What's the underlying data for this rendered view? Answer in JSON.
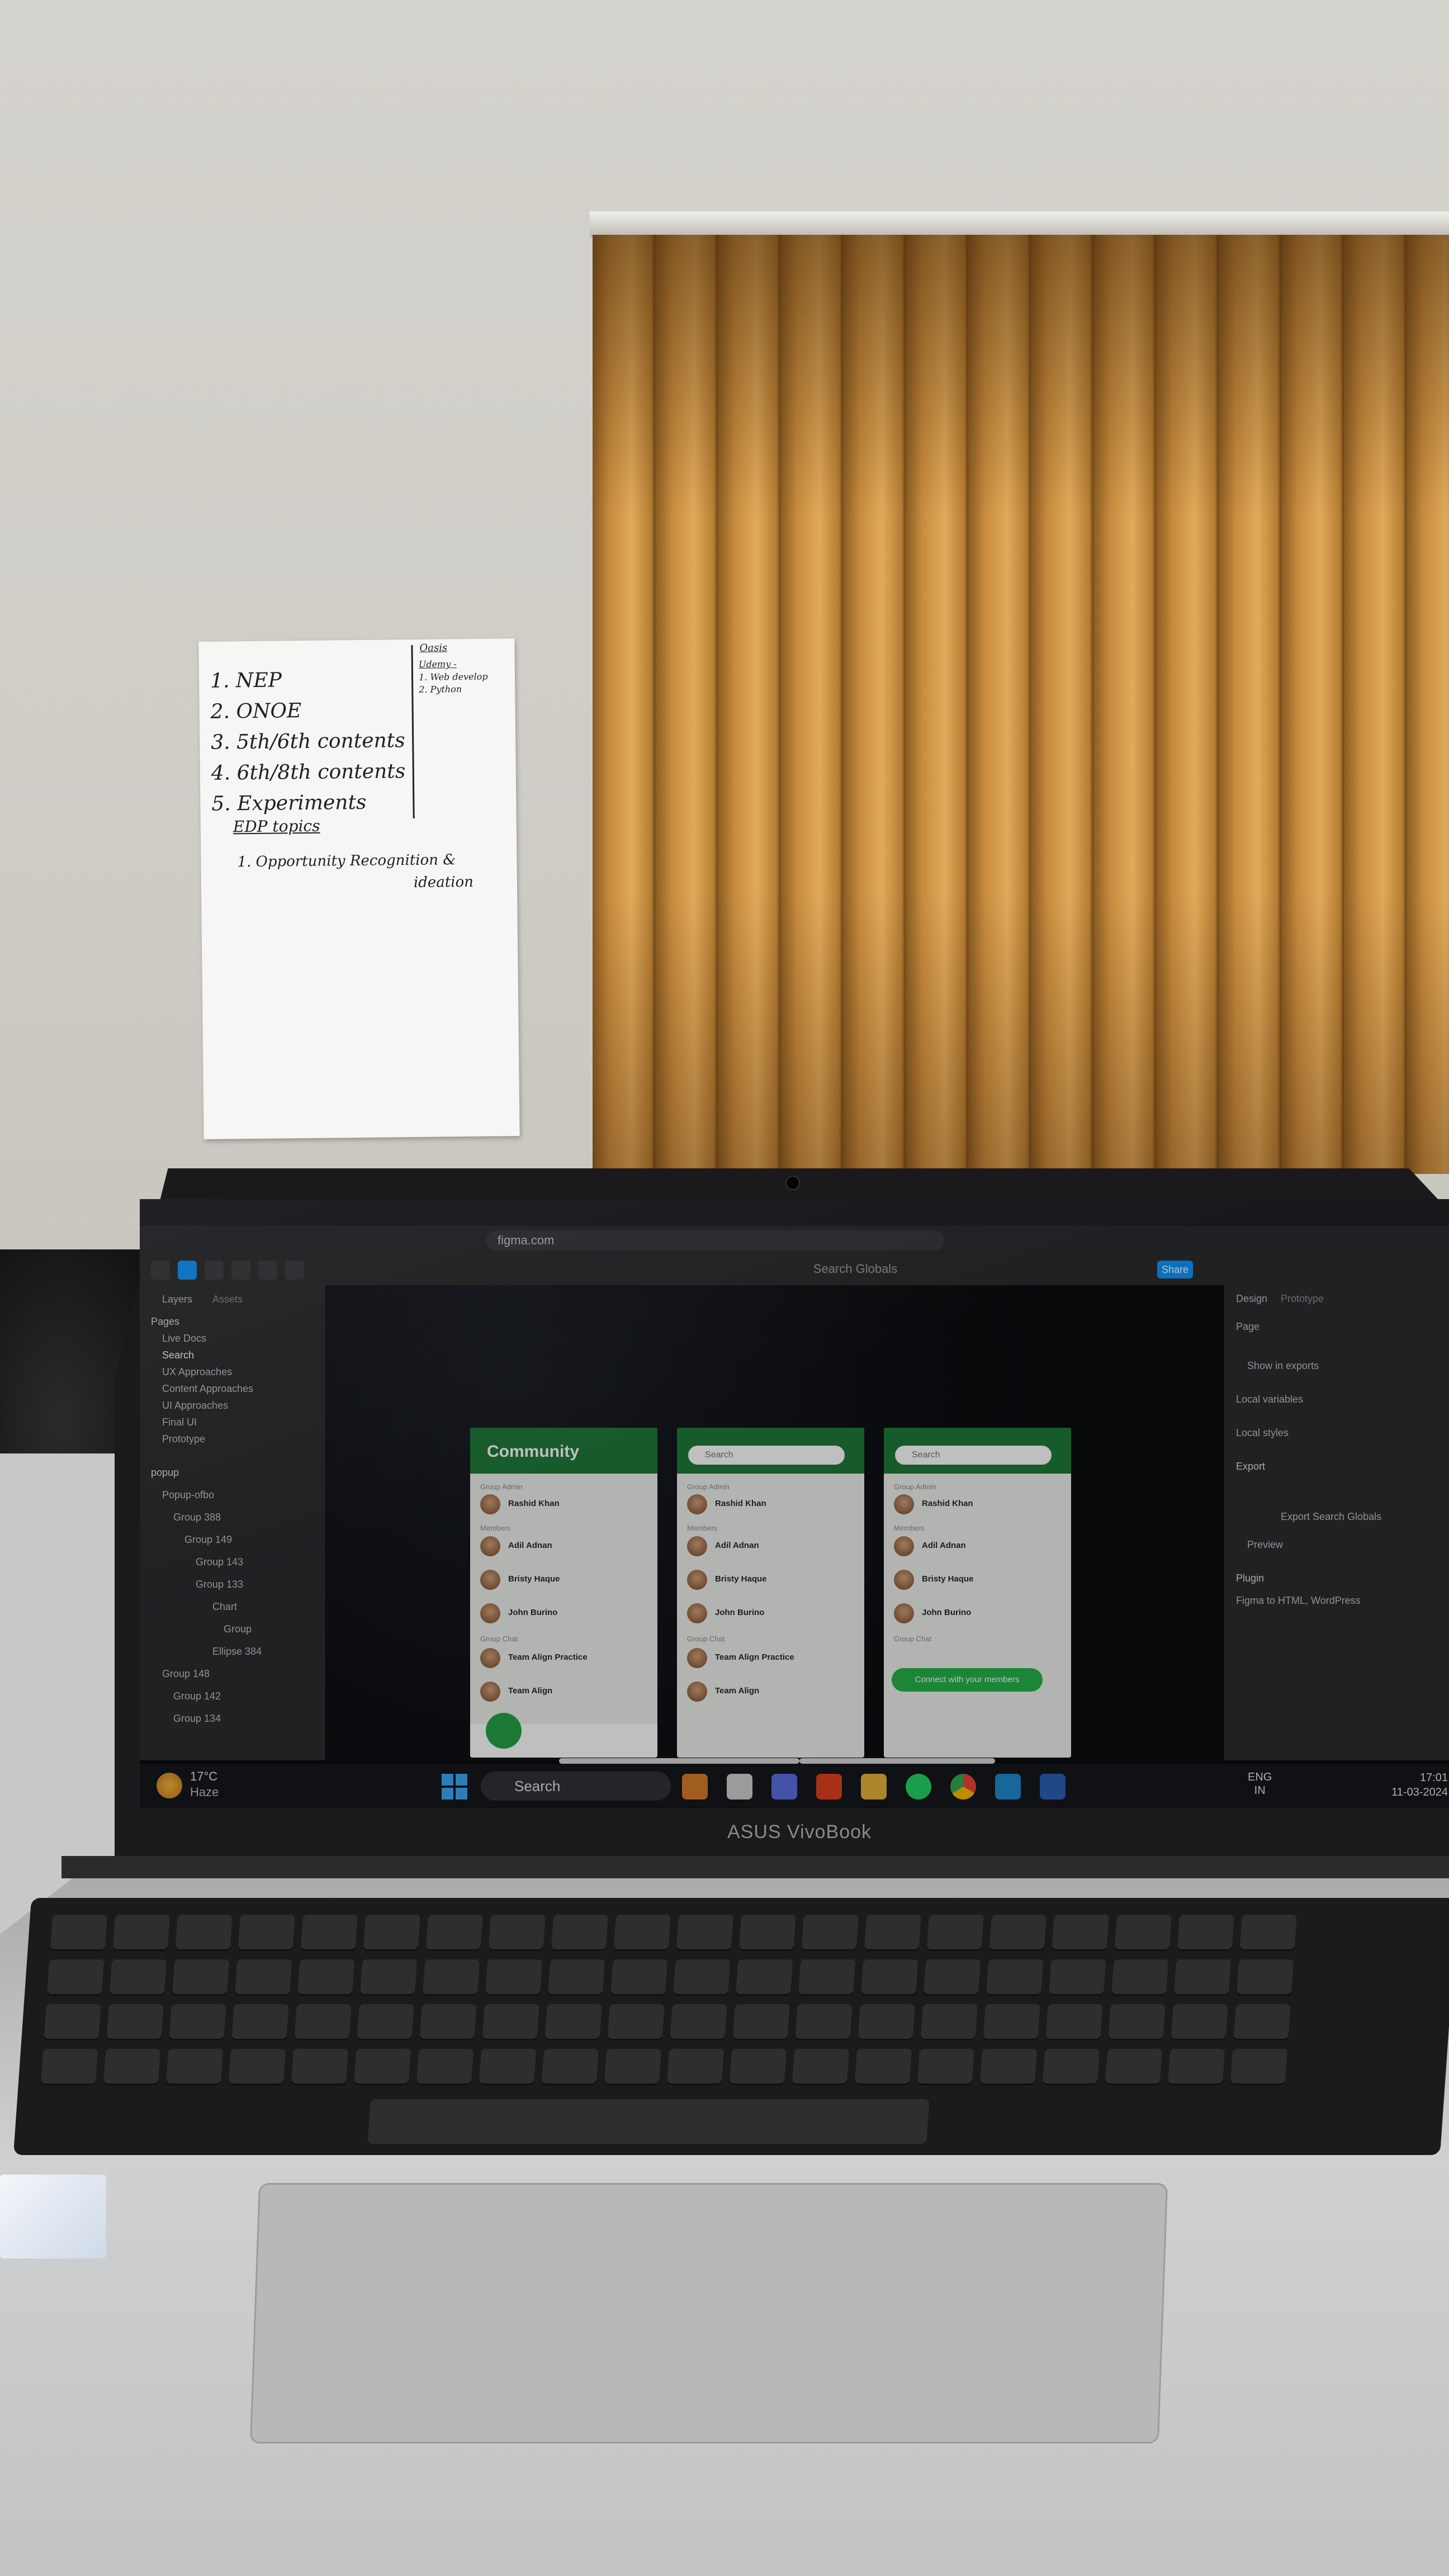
{
  "note": {
    "left_items": [
      "1. NEP",
      "2. ONOE",
      "3. 5th/6th contents",
      "4. 6th/8th contents",
      "5. Experiments",
      "EDP topics"
    ],
    "right_items": [
      "Oasis",
      "Udemy -",
      "1. Web develop",
      "2. Python"
    ],
    "bottom": [
      "1. Opportunity Recognition &",
      "ideation"
    ]
  },
  "browser": {
    "url": "figma.com"
  },
  "figma": {
    "file_title": "Search Globals",
    "share_label": "Share",
    "left_panel": {
      "tabs": [
        "Layers",
        "Assets"
      ],
      "pages_label": "Pages",
      "pages": [
        "Live Docs",
        "Search",
        "UX Approaches",
        "Content Approaches",
        "UI Approaches",
        "Final UI",
        "Prototype"
      ],
      "layers": [
        "popup",
        "Popup-ofbo",
        "Group 388",
        "Group 149",
        "Group 143",
        "Group 133",
        "Chart",
        "Group",
        "Ellipse 384",
        "Group 148",
        "Group 142",
        "Group 134"
      ]
    },
    "right_panel": {
      "tabs": [
        "Design",
        "Prototype"
      ],
      "page_label": "Page",
      "show_in_exports": "Show in exports",
      "local_variables": "Local variables",
      "local_styles": "Local styles",
      "export_label": "Export",
      "export_button": "Export Search Globals",
      "preview_label": "Preview",
      "plugin_label": "Plugin",
      "plugin_name": "Figma to HTML, WordPress"
    },
    "frames": [
      {
        "header": "Community",
        "group_admin": "Group Admin",
        "admin": "Rashid Khan",
        "members_label": "Members",
        "members": [
          "Adil Adnan",
          "Bristy Haque",
          "John Burino"
        ],
        "group_chat_label": "Group Chat",
        "chats": [
          "Team Align Practice",
          "Team Align"
        ]
      },
      {
        "search_placeholder": "Search",
        "group_admin": "Group Admin",
        "admin": "Rashid Khan",
        "members_label": "Members",
        "members": [
          "Adil Adnan",
          "Bristy Haque",
          "John Burino"
        ],
        "group_chat_label": "Group Chat",
        "chats": [
          "Team Align Practice",
          "Team Align"
        ]
      },
      {
        "search_placeholder": "Search",
        "group_admin": "Group Admin",
        "admin": "Rashid Khan",
        "members_label": "Members",
        "members": [
          "Adil Adnan",
          "Bristy Haque",
          "John Burino"
        ],
        "group_chat_label": "Group Chat",
        "whatsapp_button": "Connect with your members"
      }
    ]
  },
  "taskbar": {
    "weather_temp": "17°C",
    "weather_cond": "Haze",
    "search_label": "Search",
    "lang_line1": "ENG",
    "lang_line2": "IN",
    "time": "17:01",
    "date": "11-03-2024"
  },
  "laptop": {
    "brand": "ASUS VivoBook"
  },
  "colors": {
    "figma_green": "#1f7a3a",
    "whatsapp_green": "#25b34a",
    "figma_blue": "#0d99ff",
    "blind_amber": "#c88c3e"
  }
}
